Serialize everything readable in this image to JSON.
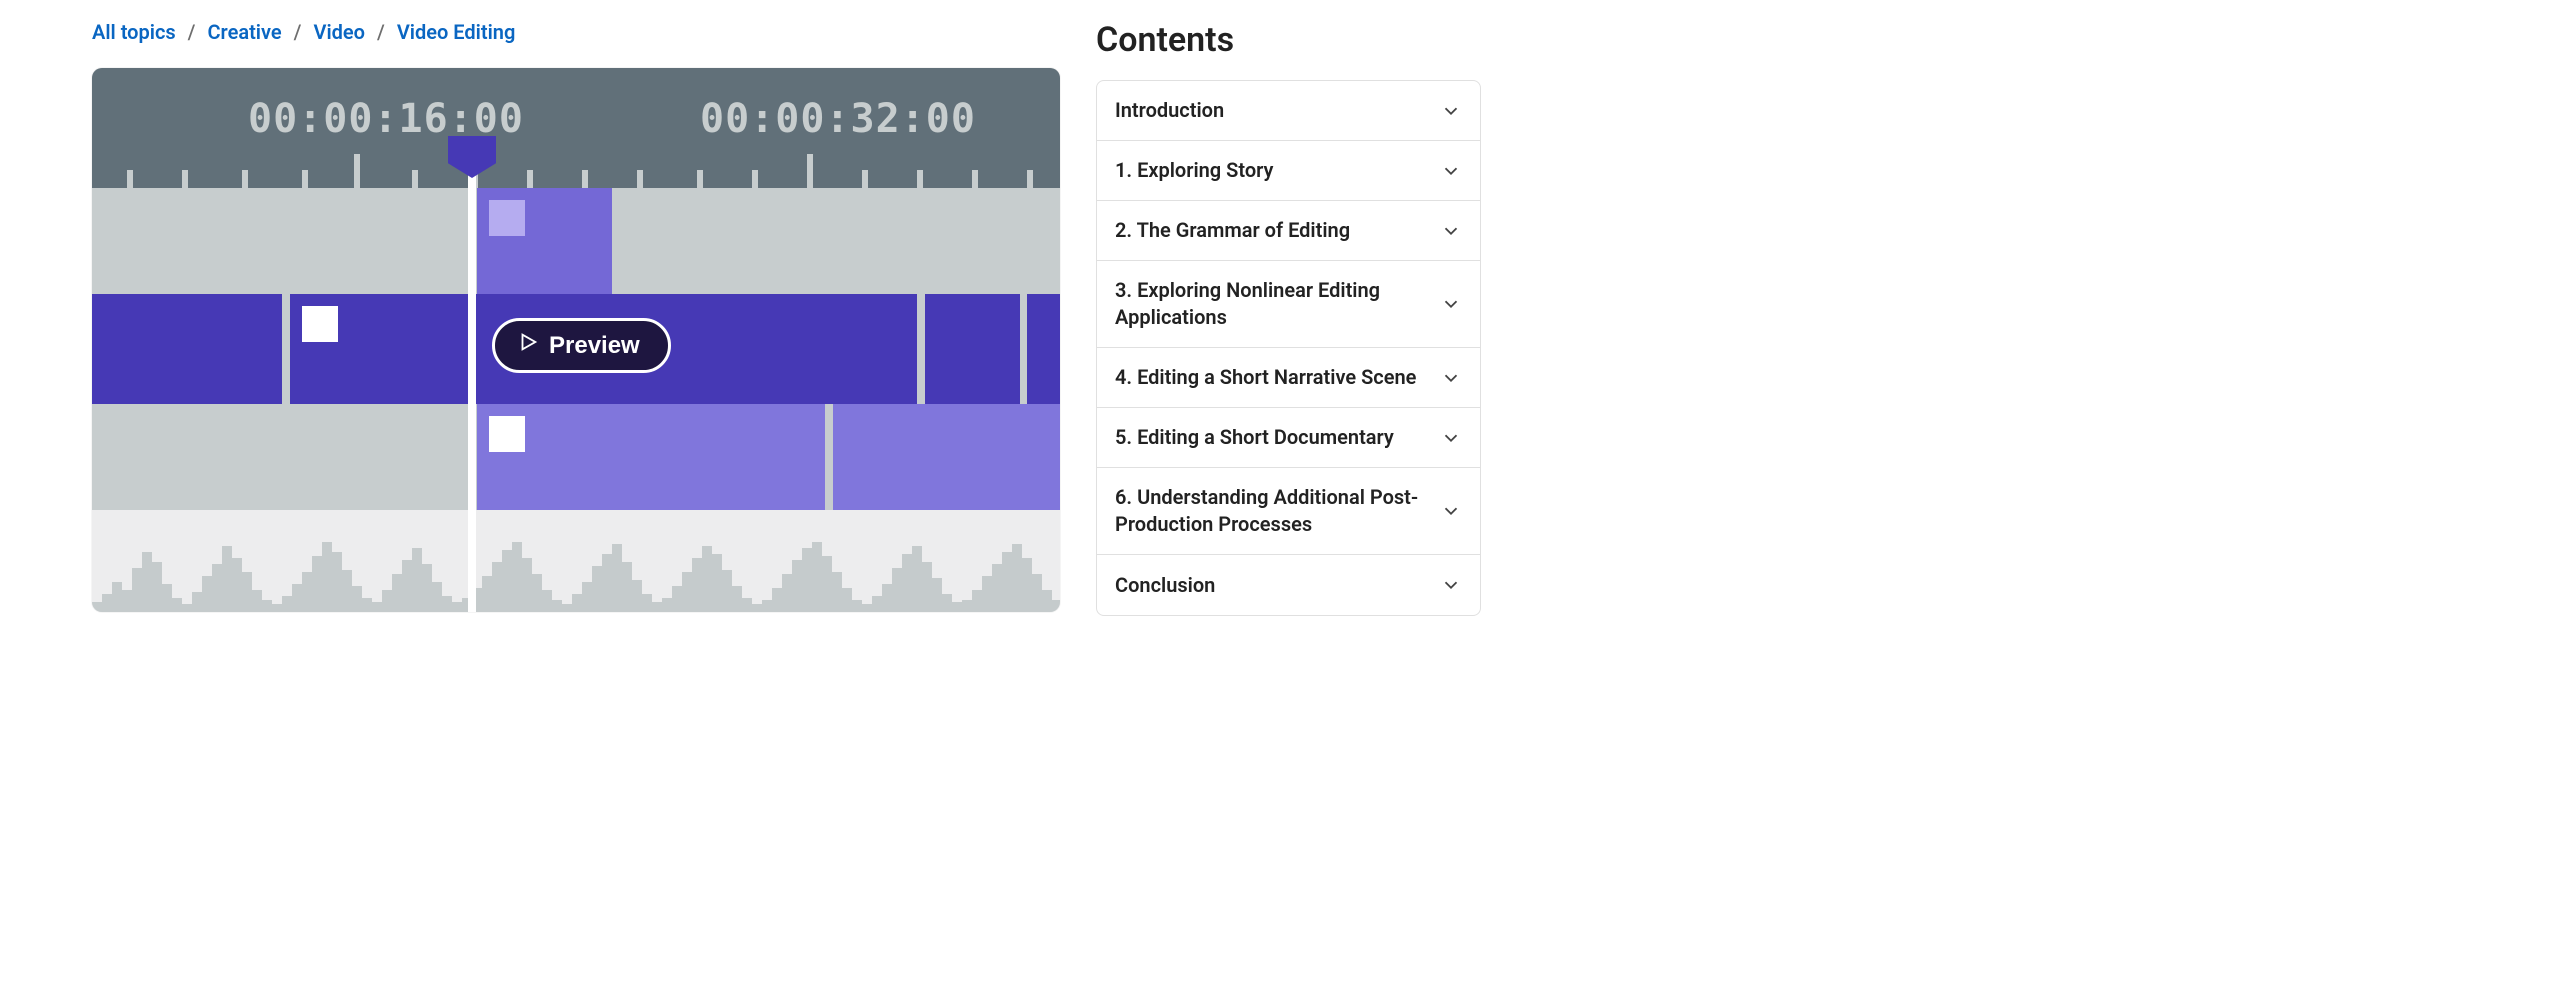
{
  "breadcrumbs": [
    {
      "label": "All topics"
    },
    {
      "label": "Creative"
    },
    {
      "label": "Video"
    },
    {
      "label": "Video Editing"
    }
  ],
  "timeline": {
    "timecode1": "00:00:16:00",
    "timecode2": "00:00:32:00",
    "preview_label": "Preview"
  },
  "contents": {
    "title": "Contents",
    "items": [
      {
        "label": "Introduction"
      },
      {
        "label": "1. Exploring Story"
      },
      {
        "label": "2. The Grammar of Editing"
      },
      {
        "label": "3. Exploring Nonlinear Editing Applications"
      },
      {
        "label": "4. Editing a Short Narrative Scene"
      },
      {
        "label": "5. Editing a Short Documentary"
      },
      {
        "label": "6. Understanding Additional Post-Production Processes"
      },
      {
        "label": "Conclusion"
      }
    ]
  }
}
